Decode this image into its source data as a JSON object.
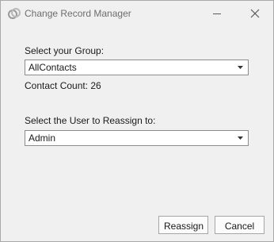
{
  "window": {
    "title": "Change Record Manager",
    "icons": {
      "app": "app-logo-icon",
      "minimize": "minimize-icon",
      "close": "close-icon"
    }
  },
  "group": {
    "label": "Select your Group:",
    "selected": "AllContacts",
    "count_label": "Contact Count: 26"
  },
  "user": {
    "label": "Select the User to Reassign to:",
    "selected": "Admin"
  },
  "buttons": {
    "reassign": "Reassign",
    "cancel": "Cancel"
  },
  "colors": {
    "background": "#f0f0f0",
    "title_text": "#6d6d6d"
  }
}
